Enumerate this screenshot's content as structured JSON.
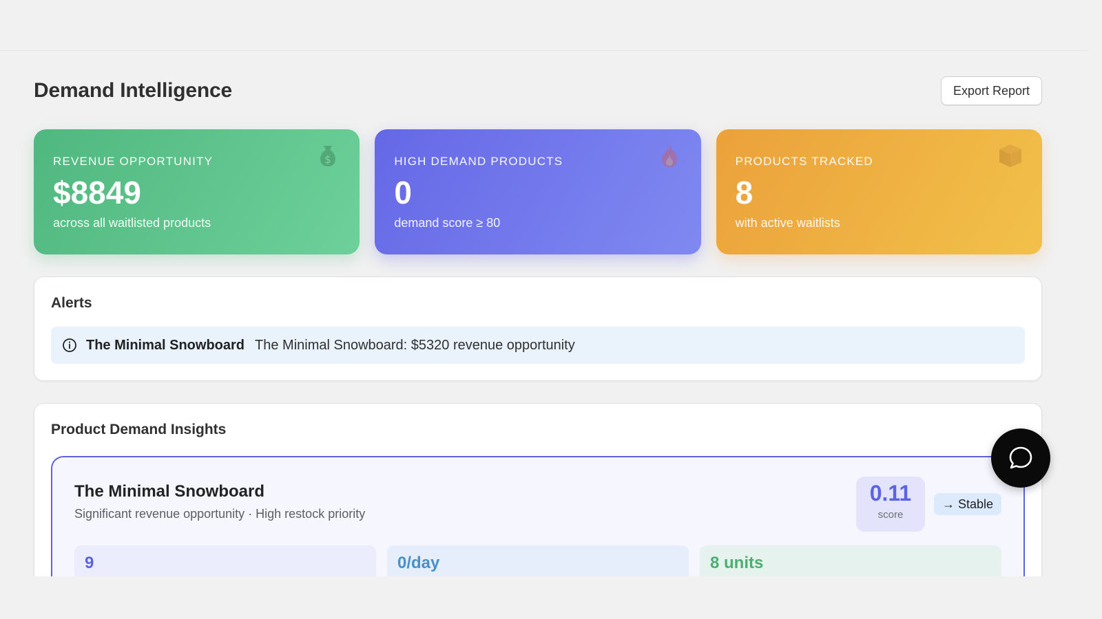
{
  "header": {
    "title": "Demand Intelligence",
    "export_label": "Export Report"
  },
  "stats": [
    {
      "label": "REVENUE OPPORTUNITY",
      "value": "$8849",
      "sub": "across all waitlisted products",
      "icon": "money-bag-icon",
      "color": "#4fb87f"
    },
    {
      "label": "HIGH DEMAND PRODUCTS",
      "value": "0",
      "sub": "demand score ≥ 80",
      "icon": "fire-icon",
      "color": "#6568e6"
    },
    {
      "label": "PRODUCTS TRACKED",
      "value": "8",
      "sub": "with active waitlists",
      "icon": "package-icon",
      "color": "#eba13a"
    }
  ],
  "alerts": {
    "title": "Alerts",
    "items": [
      {
        "icon": "info-icon",
        "product": "The Minimal Snowboard",
        "message": "The Minimal Snowboard: $5320 revenue opportunity"
      }
    ]
  },
  "insights": {
    "title": "Product Demand Insights",
    "products": [
      {
        "name": "The Minimal Snowboard",
        "description": "Significant revenue opportunity · High restock priority",
        "score": "0.11",
        "score_label": "score",
        "trend": "→ Stable",
        "metrics": [
          "9",
          "0/day",
          "8 units"
        ]
      }
    ]
  },
  "chat": {
    "icon": "chat-bubble-icon"
  }
}
